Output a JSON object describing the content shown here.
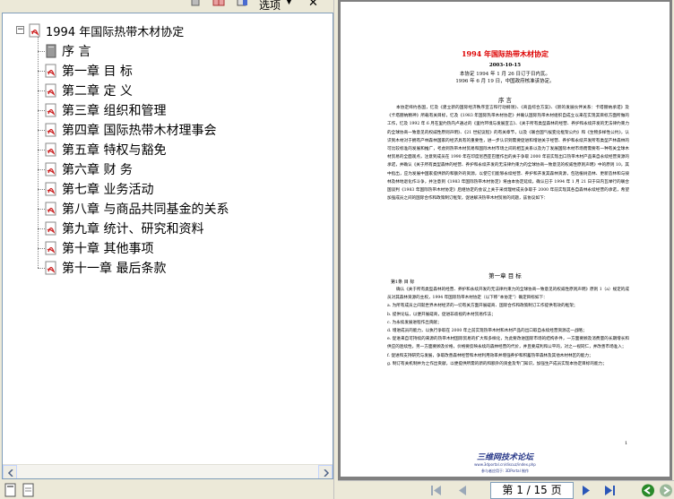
{
  "toolbar": {
    "options_label": "选项",
    "close_label": "✕"
  },
  "bookmarks": {
    "root": "1994 年国际热带木材协定",
    "items": [
      "序 言",
      "第一章 目 标",
      "第二章 定 义",
      "第三章 组织和管理",
      "第四章 国际热带木材理事会",
      "第五章 特权与豁免",
      "第六章 财 务",
      "第七章 业务活动",
      "第八章 与商品共同基金的关系",
      "第九章 统计、研究和资料",
      "第十章 其他事项",
      "第十一章 最后条款"
    ]
  },
  "document": {
    "title": "1994 年国际热带木材协定",
    "date": "2003-10-15",
    "adopted": "本协定 1994 年 1 月 26 日订于日内瓦。",
    "effective": "1996 年 6 月 19 日，中国政府核准该协定。",
    "preamble_heading": "序 言",
    "preamble_text": "本协定缔约各国，忆及《建立新的国际经济秩序宣言和行动纲领》、《商品综合方案》、《新的发展伙伴关系：卡塔赫纳承诺》及《卡塔赫纳精神》所载有关目标，忆及《1983 年国际热带木材协定》并确认国际热带木材组织自成立以来在实现其目标方面所做的工作，忆及 1992 年 6 月在里约热内卢通过的《里约环境与发展宣言》、《关于所有类型森林的经营、养护和永续开发的无法律约束力的全球协商一致意见的权威性原则声明》、《21 世纪议程》的有关章节，以及《联合国气候变化框架公约》和《生物多样性公约》，认识到木材对于拥有产林森林国家的经济具有的重要性，进一步认识到需要促进和增进关于经营、养护和永续开发所有类型产林森林的可比较标准的发展和推广，考虑到热带木材贸易和国际木材市场之间的相互关系以及为了发展国际木材市场而需要有一种有关全球木材贸易的全面观点，注意到成员在 1990 年在印度尼西亚巴厘作出的关于争取 2000 年前实现出口热带木材产品来自永续经营资源的承诺，并确认《关于所有类型森林的经营、养护和永续开发的无法律约束力的全球协商一致意见的权威性原则声明》中的原则 10，其中指出，应为发展中国家提供新的和额外的资源，以使它们能够永续经营、养护和开发其森林资源，包括植树造林、更新造林和与毁林及林地退化作斗争，并注意到《1983 年国际热带木材协定》将由本协定延续，确认已于 1994 年 1 月 21 日于日内瓦举行的联合国谈判《1983 年国际热带木材协定》后继协定的会议上关于采伐理材成员争取于 2000 年前实现其各自森林永续经营的承诺，希望加强成员之间的国际合作和政策制订框架，促进解决热带木材贸易的问题，兹协议如下：",
    "chapter1_heading": "第一章 目 标",
    "article1_title": "第1条 目 标",
    "article1_text": "确认《关于所有类型森林的经营、养护和永续开发的无法律约束力的全球协商一致意见的权威性原则声明》原则 1（a）规定的成员对其森林资源的主权，1994 年国际热带木材协定（以下称“本协定”）确定目标如下：\na. 为所有成员之间就世界木材经济的一切有关方面开展磋商、国际合作和政策制订工作提供有效的框架；\nb. 提供论坛，以便开展磋商，促进非歧视的木材贸易作法；\nc. 为永续发展进程作出贡献；\nd. 增进成员的能力，以执行争取在 2000 年之前实现热带木材和木材产品的出口取自永续经营资源这一战略；\ne. 促进来自可持续的来源的热带木材国际贸易的扩大和多样化，为此要改进国际市场的结构条件，一方面要顾及消费量的长期增长和供应的连续性，另一方面要顾及价格，价格要反映永续的森林经营的代价，并且要成利和公平的，对之一视同仁，并改善市场准入；\nf. 促进和支持研究与发展，争取改善森林经营和木材利用效率并增强养护和积蓄热带森林及其他木材林区的能力；\ng. 制订有关机制并为之作出贡献，以便提供所需的新的和额外的资金及专门知识，加强生产成员实现本协定目标的能力；",
    "page_number": "1",
    "footer_site": "三维网技术论坛",
    "footer_url": "www.3dportal.cn/discuz/index.php",
    "footer_note": "参与者应用于: 3DPortal 制作"
  },
  "nav": {
    "page_indicator": "第 1 / 15 页"
  },
  "colors": {
    "bookmark_icon_red": "#cc2222",
    "title_red": "#dd0000",
    "footer_blue": "#2a3a8a",
    "nav_green": "#2a8a2a"
  }
}
